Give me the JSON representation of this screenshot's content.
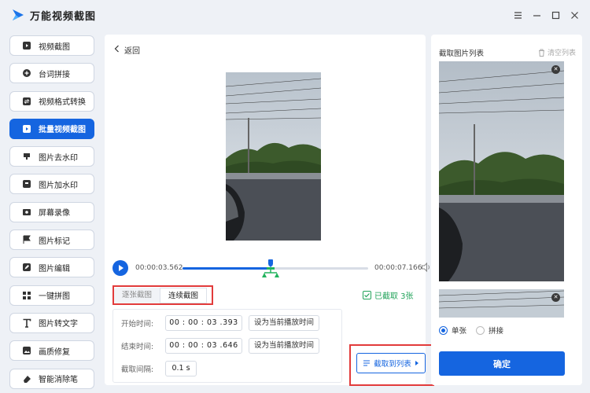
{
  "app": {
    "title": "万能视频截图"
  },
  "sidebar": {
    "items": [
      {
        "label": "视频截图",
        "icon": "video-frame-icon"
      },
      {
        "label": "台词拼接",
        "icon": "plus-circle-icon"
      },
      {
        "label": "视频格式转换",
        "icon": "convert-icon"
      },
      {
        "label": "批量视频截图",
        "icon": "batch-video-icon"
      },
      {
        "label": "图片去水印",
        "icon": "stamp-icon"
      },
      {
        "label": "图片加水印",
        "icon": "add-stamp-icon"
      },
      {
        "label": "屏幕录像",
        "icon": "screen-record-icon"
      },
      {
        "label": "图片标记",
        "icon": "flag-icon"
      },
      {
        "label": "图片编辑",
        "icon": "edit-icon"
      },
      {
        "label": "一键拼图",
        "icon": "grid-icon"
      },
      {
        "label": "图片转文字",
        "icon": "text-icon"
      },
      {
        "label": "画质修复",
        "icon": "image-repair-icon"
      },
      {
        "label": "智能消除笔",
        "icon": "eraser-icon"
      }
    ],
    "active_index": 3
  },
  "main": {
    "back_label": "返回",
    "player": {
      "current_time": "00:00:03.562",
      "end_time": "00:00:07.166",
      "progress_percent": 49
    },
    "tabs": [
      "逐张截图",
      "连续截图"
    ],
    "active_tab": 1,
    "captured_label": "已截取 3张",
    "form": {
      "start_label": "开始时间:",
      "start_value": "00 : 00 : 03 .393",
      "end_label": "结束时间:",
      "end_value": "00 : 00 : 03 .646",
      "set_current_label": "设为当前播放时间",
      "interval_label": "截取间隔:",
      "interval_value": "0.1 s"
    },
    "capture_button": "截取到列表"
  },
  "right": {
    "title": "截取图片列表",
    "clear_label": "清空列表",
    "mode_options": [
      "单张",
      "拼接"
    ],
    "mode_selected": 0,
    "confirm_label": "确定"
  },
  "colors": {
    "accent": "#1565e0",
    "highlight": "#e23b3b",
    "success": "#22a35a"
  }
}
